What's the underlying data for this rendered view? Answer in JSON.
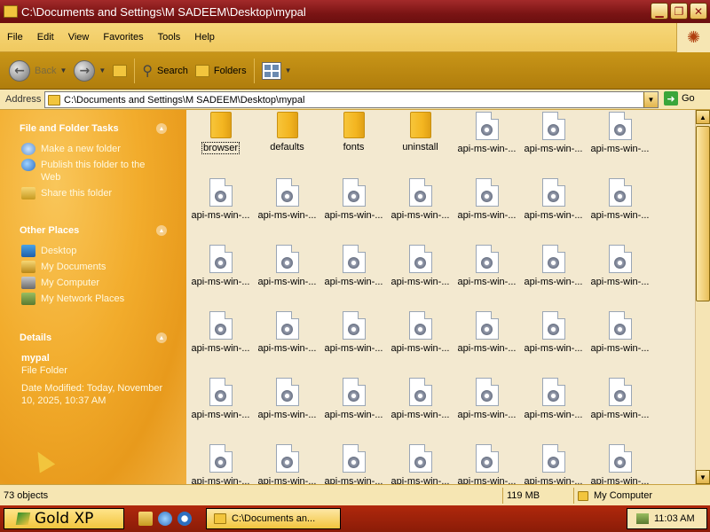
{
  "window": {
    "title": "C:\\Documents and Settings\\M SADEEM\\Desktop\\mypal",
    "controls": [
      "minimize",
      "maximize",
      "close"
    ]
  },
  "menu": [
    "File",
    "Edit",
    "View",
    "Favorites",
    "Tools",
    "Help"
  ],
  "toolbar": {
    "back_label": "Back",
    "search_label": "Search",
    "folders_label": "Folders"
  },
  "address": {
    "label": "Address",
    "value": "C:\\Documents and Settings\\M SADEEM\\Desktop\\mypal",
    "go_label": "Go"
  },
  "tasks": {
    "title": "File and Folder Tasks",
    "items": [
      {
        "label": "Make a new folder",
        "icon": "new-folder-icon"
      },
      {
        "label": "Publish this folder to the Web",
        "icon": "globe-icon"
      },
      {
        "label": "Share this folder",
        "icon": "share-icon"
      }
    ]
  },
  "places": {
    "title": "Other Places",
    "items": [
      {
        "label": "Desktop",
        "icon": "desktop-icon"
      },
      {
        "label": "My Documents",
        "icon": "documents-icon"
      },
      {
        "label": "My Computer",
        "icon": "computer-icon"
      },
      {
        "label": "My Network Places",
        "icon": "network-icon"
      }
    ]
  },
  "details": {
    "title": "Details",
    "name": "mypal",
    "type": "File Folder",
    "modified": "Date Modified: Today, November 10, 2025, 10:37 AM"
  },
  "files": [
    {
      "name": "browser",
      "kind": "folder",
      "selected": true
    },
    {
      "name": "defaults",
      "kind": "folder"
    },
    {
      "name": "fonts",
      "kind": "folder"
    },
    {
      "name": "uninstall",
      "kind": "folder"
    },
    {
      "name": "api-ms-win-...",
      "kind": "file"
    },
    {
      "name": "api-ms-win-...",
      "kind": "file"
    },
    {
      "name": "api-ms-win-...",
      "kind": "file"
    },
    {
      "name": "api-ms-win-...",
      "kind": "file"
    },
    {
      "name": "api-ms-win-...",
      "kind": "file"
    },
    {
      "name": "api-ms-win-...",
      "kind": "file"
    },
    {
      "name": "api-ms-win-...",
      "kind": "file"
    },
    {
      "name": "api-ms-win-...",
      "kind": "file"
    },
    {
      "name": "api-ms-win-...",
      "kind": "file"
    },
    {
      "name": "api-ms-win-...",
      "kind": "file"
    },
    {
      "name": "api-ms-win-...",
      "kind": "file"
    },
    {
      "name": "api-ms-win-...",
      "kind": "file"
    },
    {
      "name": "api-ms-win-...",
      "kind": "file"
    },
    {
      "name": "api-ms-win-...",
      "kind": "file"
    },
    {
      "name": "api-ms-win-...",
      "kind": "file"
    },
    {
      "name": "api-ms-win-...",
      "kind": "file"
    },
    {
      "name": "api-ms-win-...",
      "kind": "file"
    },
    {
      "name": "api-ms-win-...",
      "kind": "file"
    },
    {
      "name": "api-ms-win-...",
      "kind": "file"
    },
    {
      "name": "api-ms-win-...",
      "kind": "file"
    },
    {
      "name": "api-ms-win-...",
      "kind": "file"
    },
    {
      "name": "api-ms-win-...",
      "kind": "file"
    },
    {
      "name": "api-ms-win-...",
      "kind": "file"
    },
    {
      "name": "api-ms-win-...",
      "kind": "file"
    },
    {
      "name": "api-ms-win-...",
      "kind": "file"
    },
    {
      "name": "api-ms-win-...",
      "kind": "file"
    },
    {
      "name": "api-ms-win-...",
      "kind": "file"
    },
    {
      "name": "api-ms-win-...",
      "kind": "file"
    },
    {
      "name": "api-ms-win-...",
      "kind": "file"
    },
    {
      "name": "api-ms-win-...",
      "kind": "file"
    },
    {
      "name": "api-ms-win-...",
      "kind": "file"
    },
    {
      "name": "api-ms-win-...",
      "kind": "file"
    },
    {
      "name": "api-ms-win-...",
      "kind": "file"
    },
    {
      "name": "api-ms-win-...",
      "kind": "file"
    },
    {
      "name": "api-ms-win-...",
      "kind": "file"
    },
    {
      "name": "api-ms-win-...",
      "kind": "file"
    },
    {
      "name": "api-ms-win-...",
      "kind": "file"
    },
    {
      "name": "api-ms-win-...",
      "kind": "file"
    }
  ],
  "status": {
    "count": "73 objects",
    "size": "119 MB",
    "location": "My Computer"
  },
  "taskbar": {
    "start_label": "Gold XP",
    "window_button": "C:\\Documents an...",
    "clock": "11:03 AM"
  },
  "colors": {
    "titlebar": "#7a1414",
    "panel": "#f2ac2c",
    "content_bg": "#f3e9d0",
    "taskbar": "#8a1c08"
  }
}
